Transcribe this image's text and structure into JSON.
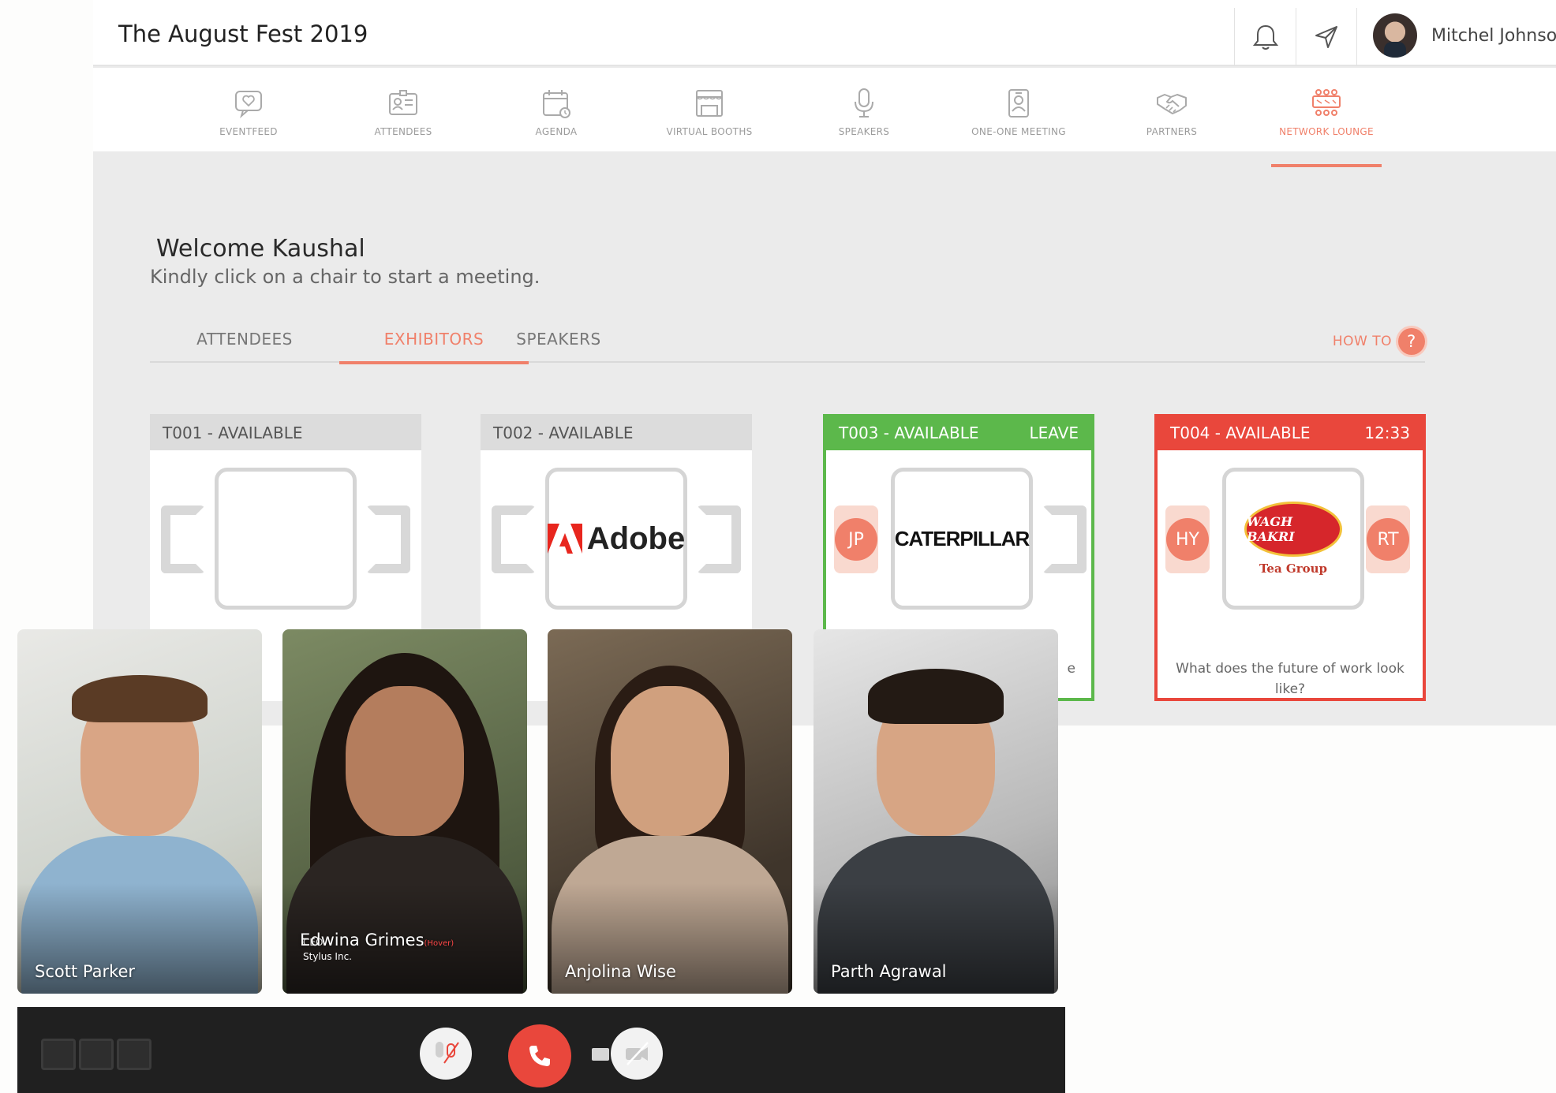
{
  "header": {
    "event_title": "The August Fest 2019",
    "user_name": "Mitchel Johnson",
    "icons": [
      "bell-icon",
      "send-icon"
    ]
  },
  "nav": {
    "items": [
      {
        "label": "EVENTFEED",
        "icon": "chat-heart-icon"
      },
      {
        "label": "ATTENDEES",
        "icon": "id-card-icon"
      },
      {
        "label": "AGENDA",
        "icon": "calendar-icon"
      },
      {
        "label": "VIRTUAL BOOTHS",
        "icon": "booth-icon"
      },
      {
        "label": "SPEAKERS",
        "icon": "microphone-icon"
      },
      {
        "label": "ONE-ONE MEETING",
        "icon": "badge-icon"
      },
      {
        "label": "PARTNERS",
        "icon": "handshake-icon"
      },
      {
        "label": "NETWORK LOUNGE",
        "icon": "lounge-icon"
      }
    ],
    "active_index": 7,
    "accent_color": "#f0806a"
  },
  "welcome": {
    "title": "Welcome Kaushal",
    "subtitle": "Kindly click on a chair to start a meeting."
  },
  "tabs": {
    "items": [
      "ATTENDEES",
      "EXHIBITORS",
      "SPEAKERS"
    ],
    "active_index": 1,
    "howto_label": "HOW TO",
    "howto_icon_text": "?"
  },
  "tables": [
    {
      "title": "T001 - AVAILABLE",
      "action": "",
      "logo": "",
      "left_seat": "",
      "right_seat": "",
      "topic": "",
      "state": "default"
    },
    {
      "title": "T002 - AVAILABLE",
      "action": "",
      "logo": "Adobe",
      "left_seat": "",
      "right_seat": "",
      "topic": "",
      "state": "default"
    },
    {
      "title": "T003 - AVAILABLE",
      "action": "LEAVE",
      "logo": "CATERPILLAR",
      "left_seat": "JP",
      "right_seat": "",
      "topic": "e",
      "state": "joined",
      "color": "#5cb84b"
    },
    {
      "title": "T004 - AVAILABLE",
      "action": "12:33",
      "logo": "WAGH BAKRI",
      "logo_sub": "Tea Group",
      "left_seat": "HY",
      "right_seat": "RT",
      "topic": "What does the future of work look like?",
      "state": "active",
      "color": "#e9473c"
    }
  ],
  "video": {
    "participants": [
      {
        "name": "Scott Parker",
        "role": "",
        "company": ""
      },
      {
        "name": "Edwina Grimes",
        "hover_tag": "(Hover)",
        "role": "CEO",
        "company": "Stylus Inc."
      },
      {
        "name": "Anjolina Wise",
        "role": "",
        "company": ""
      },
      {
        "name": "Parth Agrawal",
        "role": "",
        "company": ""
      }
    ],
    "controls": {
      "mic": "mic-muted-icon",
      "end_call": "phone-icon",
      "camera": "camera-off-icon",
      "end_call_color": "#e9473c"
    }
  }
}
